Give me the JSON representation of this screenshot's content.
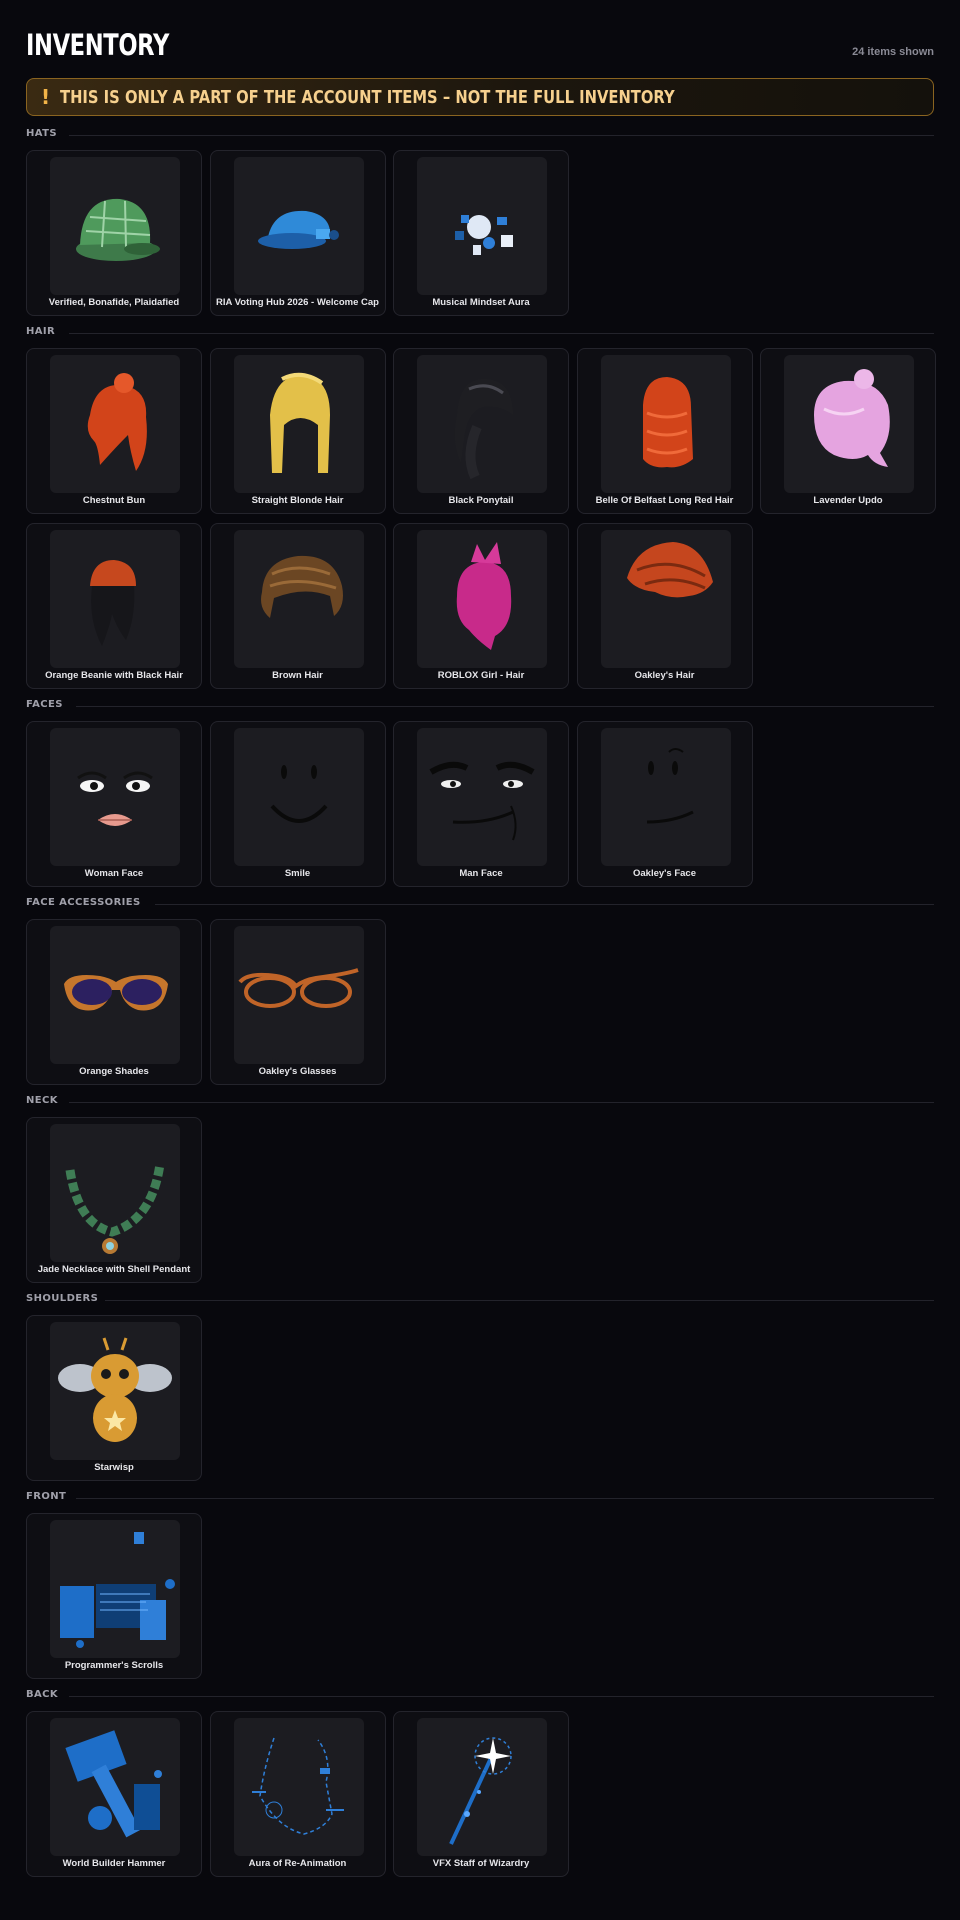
{
  "page": {
    "title": "INVENTORY",
    "items_shown": "24 items shown",
    "warning_icon": "!",
    "warning": "THIS IS ONLY A PART OF THE ACCOUNT ITEMS – NOT THE FULL INVENTORY"
  },
  "colors": {
    "background": "#08080d",
    "card": "#0e0e13",
    "thumb": "#1c1c21",
    "warning_text": "#f6d08e",
    "warning_border": "#8a6420"
  },
  "sections": [
    {
      "label": "HATS",
      "items": [
        {
          "name": "Verified, Bonafide, Plaidafied",
          "icon": "green-plaid-cap"
        },
        {
          "name": "RIA Voting Hub 2026 - Welcome Cap",
          "icon": "blue-cap"
        },
        {
          "name": "Musical Mindset Aura",
          "icon": "music-aura"
        }
      ]
    },
    {
      "label": "HAIR",
      "items": [
        {
          "name": "Chestnut Bun",
          "icon": "red-hair-bun"
        },
        {
          "name": "Straight Blonde Hair",
          "icon": "blonde-hair"
        },
        {
          "name": "Black Ponytail",
          "icon": "black-ponytail"
        },
        {
          "name": "Belle Of Belfast Long Red Hair",
          "icon": "long-red-hair"
        },
        {
          "name": "Lavender Updo",
          "icon": "lavender-hair"
        },
        {
          "name": "Orange Beanie with Black Hair",
          "icon": "beanie-hair"
        },
        {
          "name": "Brown Hair",
          "icon": "brown-hair"
        },
        {
          "name": "ROBLOX Girl - Hair",
          "icon": "pink-hair"
        },
        {
          "name": "Oakley's Hair",
          "icon": "orange-hair"
        }
      ]
    },
    {
      "label": "FACES",
      "items": [
        {
          "name": "Woman Face",
          "icon": "woman-face"
        },
        {
          "name": "Smile",
          "icon": "smile-face"
        },
        {
          "name": "Man Face",
          "icon": "man-face"
        },
        {
          "name": "Oakley's Face",
          "icon": "smirk-face"
        }
      ]
    },
    {
      "label": "FACE ACCESSORIES",
      "items": [
        {
          "name": "Orange Shades",
          "icon": "sunglasses"
        },
        {
          "name": "Oakley's Glasses",
          "icon": "glasses"
        }
      ]
    },
    {
      "label": "NECK",
      "items": [
        {
          "name": "Jade Necklace with Shell Pendant",
          "icon": "necklace"
        }
      ]
    },
    {
      "label": "SHOULDERS",
      "items": [
        {
          "name": "Starwisp",
          "icon": "fairy-pet"
        }
      ]
    },
    {
      "label": "FRONT",
      "items": [
        {
          "name": "Programmer's Scrolls",
          "icon": "scrolls"
        }
      ]
    },
    {
      "label": "BACK",
      "items": [
        {
          "name": "World Builder Hammer",
          "icon": "hammer"
        },
        {
          "name": "Aura of Re-Animation",
          "icon": "blue-aura"
        },
        {
          "name": "VFX Staff of Wizardry",
          "icon": "staff"
        }
      ]
    }
  ]
}
